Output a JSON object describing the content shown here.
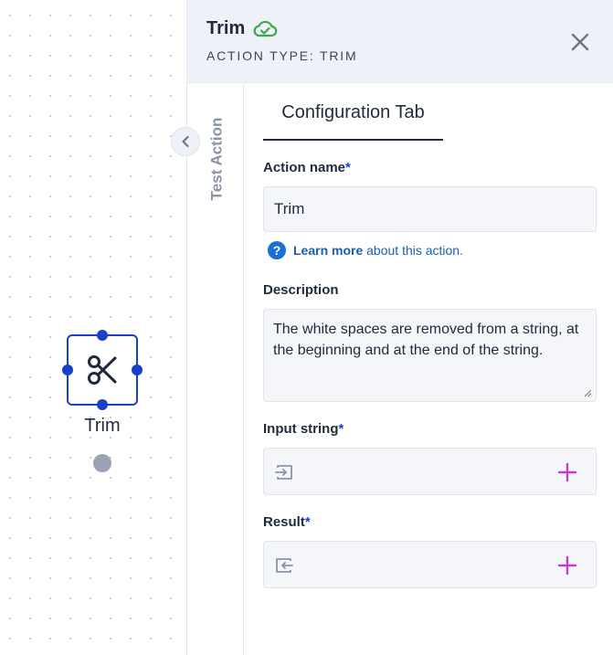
{
  "canvas": {
    "node": {
      "label": "Trim",
      "icon": "scissors-icon",
      "color": "#1a3fc9"
    }
  },
  "panel": {
    "title": "Trim",
    "status_icon": "cloud-check-icon",
    "subtitle": "ACTION TYPE: TRIM",
    "side_tab": "Test Action",
    "tab": "Configuration Tab",
    "action_name": {
      "label": "Action name",
      "required": "*",
      "value": "Trim"
    },
    "learn_more": {
      "link": "Learn more",
      "rest": " about this action."
    },
    "description": {
      "label": "Description",
      "value": "The white spaces are removed from a string, at the beginning and at the end of the string."
    },
    "input_string": {
      "label": "Input string",
      "required": "*"
    },
    "result": {
      "label": "Result",
      "required": "*"
    }
  },
  "colors": {
    "accent": "#1a3fc9",
    "success": "#3aa84a",
    "plus": "#c13ccf",
    "link": "#1a5fb4"
  }
}
